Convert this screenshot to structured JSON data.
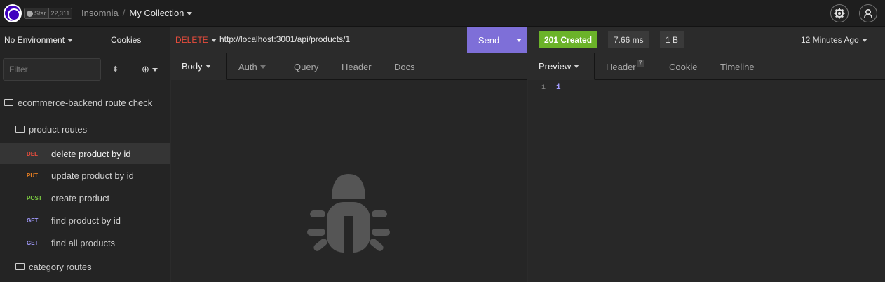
{
  "header": {
    "star_label": "Star",
    "star_count": "22,311",
    "breadcrumb_root": "Insomnia",
    "breadcrumb_sep": "/",
    "collection_name": "My Collection"
  },
  "sidebar": {
    "environment": "No Environment",
    "cookies": "Cookies",
    "filter_placeholder": "Filter",
    "workspace": "ecommerce-backend route check",
    "folders": [
      {
        "name": "product routes",
        "expanded": true
      },
      {
        "name": "category routes",
        "expanded": false
      }
    ],
    "requests": [
      {
        "method": "DEL",
        "name": "delete product by id",
        "active": true
      },
      {
        "method": "PUT",
        "name": "update product by id"
      },
      {
        "method": "POST",
        "name": "create product"
      },
      {
        "method": "GET",
        "name": "find product by id"
      },
      {
        "method": "GET",
        "name": "find all products"
      }
    ]
  },
  "request": {
    "method": "DELETE",
    "url": "http://localhost:3001/api/products/1",
    "send_label": "Send",
    "tabs": [
      "Body",
      "Auth",
      "Query",
      "Header",
      "Docs"
    ]
  },
  "response": {
    "status": "201 Created",
    "time": "7.66 ms",
    "size": "1 B",
    "ago": "12 Minutes Ago",
    "tabs": [
      "Preview",
      "Header",
      "Cookie",
      "Timeline"
    ],
    "header_count": "7",
    "line_number": "1",
    "body": "1"
  },
  "colors": {
    "accent": "#7e6fd8",
    "success": "#6bb329",
    "delete": "#e74c3c"
  }
}
